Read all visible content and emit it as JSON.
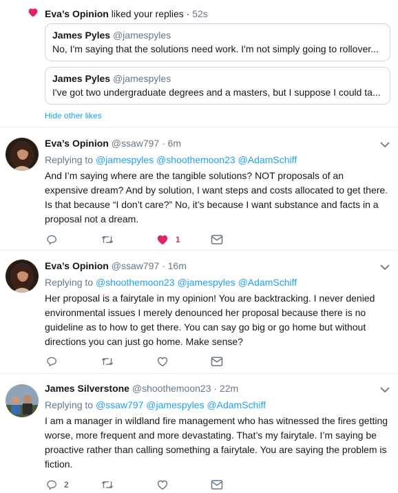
{
  "activity": {
    "actor": "Eva’s Opinion",
    "action": " liked your replies · ",
    "time": "52s",
    "quotes": [
      {
        "name": "James Pyles",
        "handle": "@jamespyles",
        "text": "No, I'm saying that the solutions need work. I'm not simply going to rollover..."
      },
      {
        "name": "James Pyles",
        "handle": "@jamespyles",
        "text": "I've got two undergraduate degrees and a masters, but I suppose I could ta..."
      }
    ],
    "hide_label": "Hide other likes"
  },
  "tweets": [
    {
      "name": "Eva’s Opinion",
      "meta": "@ssaw797 · 6m",
      "replying_prefix": "Replying to ",
      "replying_to": "@jamespyles @shoothemoon23 @AdamSchiff",
      "text": "And I’m saying where are the tangible solutions? NOT proposals of an expensive dream? And by solution, I want steps and costs allocated to get there. Is that because “I don’t care?” No, it’s because I want substance and facts in a proposal not a dream.",
      "reply_count": "",
      "like_count": "1",
      "liked": true
    },
    {
      "name": "Eva’s Opinion",
      "meta": "@ssaw797 · 16m",
      "replying_prefix": "Replying to ",
      "replying_to": "@shoothemoon23 @jamespyles @AdamSchiff",
      "text": "Her proposal is a fairytale in my opinion! You are backtracking. I never denied environmental issues I merely denounced her proposal because there is no guideline as to how to get there. You can say go big or go home but without directions you can just go home. Make sense?",
      "reply_count": "",
      "like_count": "",
      "liked": false
    },
    {
      "name": "James Silverstone",
      "meta": "@shoothemoon23 · 22m",
      "replying_prefix": "Replying to ",
      "replying_to": "@ssaw797 @jamespyles @AdamSchiff",
      "text": "I am a manager in wildland fire management who has witnessed the fires getting worse, more frequent and more devastating. That’s my fairytale. I’m saying be proactive rather than calling something a fairytale. You are saying the problem is fiction.",
      "reply_count": "2",
      "like_count": "",
      "liked": false
    }
  ],
  "colors": {
    "accent": "#1da1f2",
    "like": "#e0245e",
    "muted": "#657786"
  }
}
